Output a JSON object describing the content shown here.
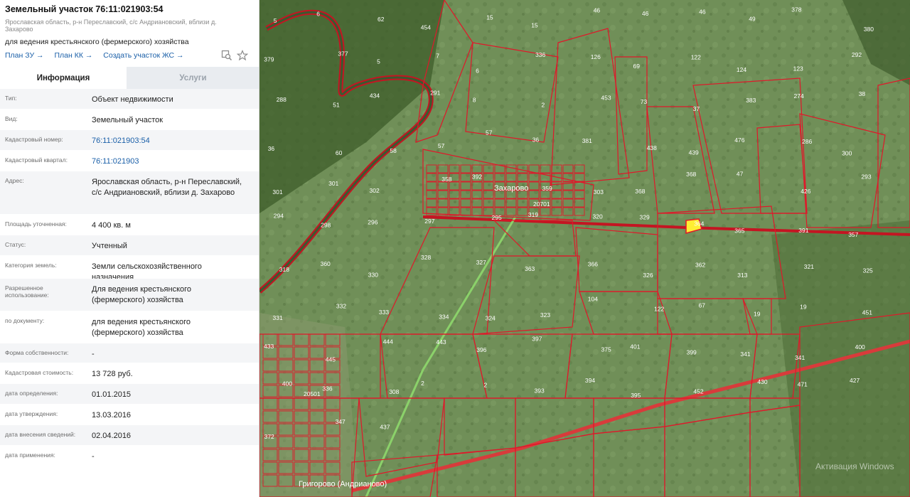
{
  "header": {
    "title": "Земельный участок 76:11:021903:54",
    "address": "Ярославская область, р-н Переславский, с/с Андриановский, вблизи д. Захарово",
    "purpose": "для ведения крестьянского (фермерского) хозяйства",
    "links": [
      "План ЗУ →",
      "План КК →",
      "Создать участок ЖС →"
    ]
  },
  "tabs": {
    "info": "Информация",
    "services": "Услуги"
  },
  "rows": [
    {
      "k": "Тип:",
      "v": "Объект недвижимости"
    },
    {
      "k": "Вид:",
      "v": "Земельный участок"
    },
    {
      "k": "Кадастровый номер:",
      "v": "76:11:021903:54"
    },
    {
      "k": "Кадастровый квартал:",
      "v": "76:11:021903"
    },
    {
      "k": "Адрес:",
      "v": "Ярославская область, р-н Переславский, с/с Андриановский, вблизи д. Захарово"
    },
    {
      "k": "Площадь уточненная:",
      "v": "4 400 кв. м"
    },
    {
      "k": "Статус:",
      "v": "Учтенный"
    },
    {
      "k": "Категория земель:",
      "v": "Земли сельскохозяйственного назначения"
    },
    {
      "k": "Разрешенное использование:",
      "v": "Для ведения крестьянского (фермерского) хозяйства"
    },
    {
      "k": "по документу:",
      "v": "для ведения крестьянского (фермерского) хозяйства"
    },
    {
      "k": "Форма собственности:",
      "v": "-"
    },
    {
      "k": "Кадастровая стоимость:",
      "v": "13 728 руб."
    },
    {
      "k": "дата определения:",
      "v": "01.01.2015"
    },
    {
      "k": "дата утверждения:",
      "v": "13.03.2016"
    },
    {
      "k": "дата внесения сведений:",
      "v": "02.04.2016"
    },
    {
      "k": "дата применения:",
      "v": "-"
    }
  ],
  "map": {
    "places": [
      "Захарово",
      "Григорово (Андрианово)"
    ],
    "quarters": [
      "20701",
      "20501"
    ],
    "parcels": [
      "5",
      "6",
      "62",
      "454",
      "15",
      "15",
      "46",
      "46",
      "46",
      "49",
      "378",
      "380",
      "379",
      "377",
      "5",
      "7",
      "6",
      "336",
      "126",
      "69",
      "122",
      "124",
      "123",
      "292",
      "288",
      "51",
      "434",
      "291",
      "8",
      "2",
      "453",
      "73",
      "37",
      "383",
      "274",
      "38",
      "36",
      "60",
      "58",
      "57",
      "57",
      "36",
      "381",
      "438",
      "439",
      "476",
      "286",
      "300",
      "301",
      "301",
      "302",
      "358",
      "392",
      "359",
      "303",
      "368",
      "368",
      "47",
      "426",
      "293",
      "294",
      "298",
      "296",
      "297",
      "295",
      "319",
      "320",
      "329",
      "364",
      "365",
      "391",
      "357",
      "318",
      "360",
      "330",
      "328",
      "327",
      "363",
      "366",
      "326",
      "362",
      "313",
      "321",
      "325",
      "331",
      "332",
      "333",
      "334",
      "324",
      "323",
      "104",
      "122",
      "67",
      "19",
      "19",
      "451",
      "433",
      "445",
      "444",
      "443",
      "396",
      "397",
      "375",
      "401",
      "399",
      "341",
      "341",
      "400",
      "400",
      "336",
      "308",
      "2",
      "2",
      "393",
      "394",
      "395",
      "452",
      "430",
      "471",
      "427",
      "372",
      "347",
      "437"
    ],
    "watermark": "Активация Windows"
  },
  "colors": {
    "accent": "#1a5fa8",
    "boundary": "#e0182a",
    "road": "#d83b3b",
    "selected": "#ffee33"
  }
}
